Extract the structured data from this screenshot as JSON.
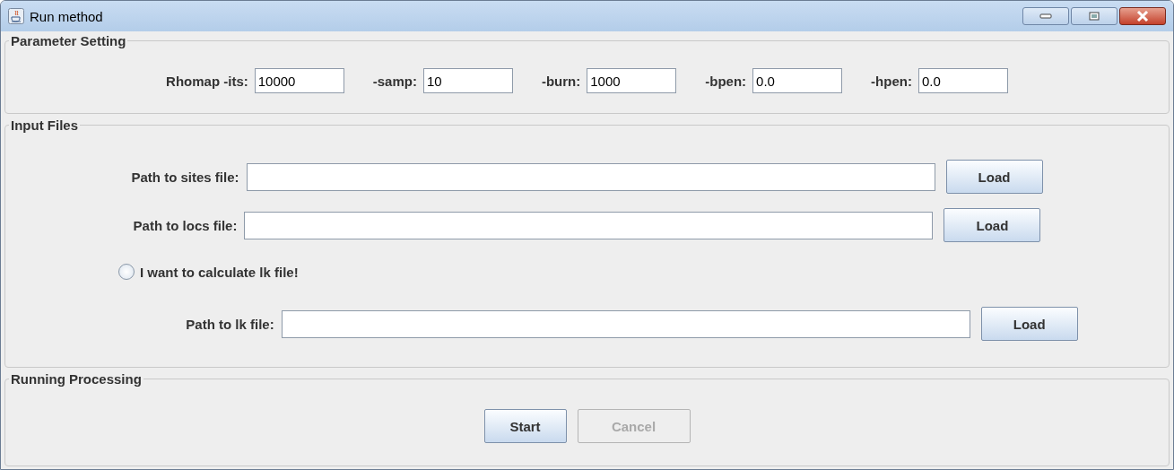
{
  "window": {
    "title": "Run method"
  },
  "parameter_setting": {
    "title": "Parameter Setting",
    "fields": [
      {
        "label": "Rhomap -its:",
        "value": "10000"
      },
      {
        "label": "-samp:",
        "value": "10"
      },
      {
        "label": "-burn:",
        "value": "1000"
      },
      {
        "label": "-bpen:",
        "value": "0.0"
      },
      {
        "label": "-hpen:",
        "value": "0.0"
      }
    ]
  },
  "input_files": {
    "title": "Input Files",
    "rows": [
      {
        "kind": "path",
        "label": "Path to sites file:",
        "button": "Load"
      },
      {
        "kind": "path",
        "label": "Path to locs file:",
        "button": "Load"
      },
      {
        "kind": "radio",
        "label": "I want to calculate lk file!",
        "checked": false
      },
      {
        "kind": "path",
        "label": "Path to lk file:",
        "button": "Load"
      }
    ]
  },
  "running_processing": {
    "title": "Running Processing",
    "buttons": [
      {
        "label": "Start",
        "disabled": false
      },
      {
        "label": "Cancel",
        "disabled": true
      }
    ]
  }
}
